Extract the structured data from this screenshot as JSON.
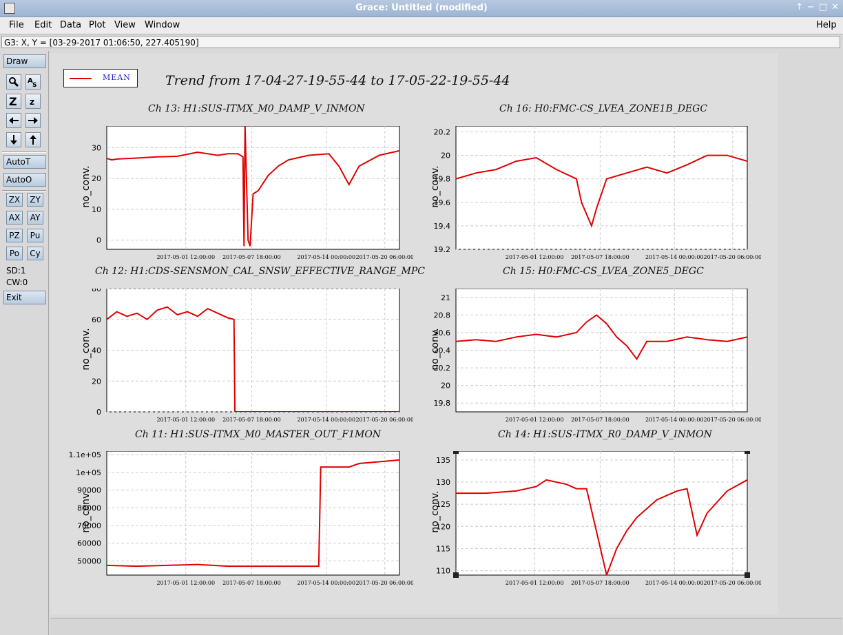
{
  "window": {
    "title": "Grace: Untitled (modified)",
    "controls": [
      "↑",
      "−",
      "□",
      "✕"
    ]
  },
  "menu": {
    "file": "File",
    "edit": "Edit",
    "data": "Data",
    "plot": "Plot",
    "view": "View",
    "window": "Window",
    "help": "Help"
  },
  "locator": "G3: X, Y = [03-29-2017 01:06:50, 227.405190]",
  "tools": {
    "draw": "Draw",
    "autot": "AutoT",
    "autoo": "AutoO",
    "exit": "Exit",
    "zx": "ZX",
    "zy": "ZY",
    "ax": "AX",
    "ay": "AY",
    "pz": "PZ",
    "pu": "Pu",
    "po": "Po",
    "cy": "Cy",
    "sd": "SD:1",
    "cw": "CW:0"
  },
  "legend": {
    "label": "MEAN",
    "color": "#e00000"
  },
  "main_title": "Trend from 17-04-27-19-55-44 to 17-05-22-19-55-44",
  "chart_data": [
    {
      "type": "line",
      "title": "Ch 13: H1:SUS-ITMX_M0_DAMP_V_INMON",
      "ylabel": "no_conv.",
      "yticks": [
        "0",
        "10",
        "20",
        "30"
      ],
      "xticks": [
        "2017-05-01 12:00:00",
        "2017-05-07 18:00:00",
        "2017-05-14 00:00:00",
        "2017-05-20 06:00:00"
      ],
      "ylim": [
        -3,
        37
      ],
      "series": [
        {
          "values": [
            [
              0,
              26.5
            ],
            [
              0.5,
              26
            ],
            [
              1,
              26.3
            ],
            [
              3,
              26.6
            ],
            [
              5,
              27
            ],
            [
              7,
              27.2
            ],
            [
              9,
              28.5
            ],
            [
              11,
              27.5
            ],
            [
              12,
              28
            ],
            [
              13,
              28
            ],
            [
              13.5,
              27
            ],
            [
              13.6,
              -2
            ],
            [
              13.7,
              37
            ],
            [
              14.0,
              0
            ],
            [
              14.2,
              -2
            ],
            [
              14.5,
              15
            ],
            [
              15,
              16
            ],
            [
              16,
              21
            ],
            [
              17,
              24
            ],
            [
              18,
              26
            ],
            [
              20,
              27.5
            ],
            [
              22,
              28
            ],
            [
              23,
              24
            ],
            [
              24,
              18
            ],
            [
              25,
              24
            ],
            [
              27,
              27.5
            ],
            [
              29,
              29
            ]
          ]
        }
      ]
    },
    {
      "type": "line",
      "title": "Ch 16: H0:FMC-CS_LVEA_ZONE1B_DEGC",
      "ylabel": "no_conv.",
      "yticks": [
        "19.2",
        "19.4",
        "19.6",
        "19.8",
        "20",
        "20.2"
      ],
      "xticks": [
        "2017-05-01 12:00:00",
        "2017-05-07 18:00:00",
        "2017-05-14 00:00:00",
        "2017-05-20 06:00:00"
      ],
      "ylim": [
        19.2,
        20.25
      ],
      "series": [
        {
          "values": [
            [
              0,
              19.8
            ],
            [
              2,
              19.85
            ],
            [
              4,
              19.88
            ],
            [
              6,
              19.95
            ],
            [
              8,
              19.98
            ],
            [
              10,
              19.88
            ],
            [
              12,
              19.8
            ],
            [
              12.5,
              19.6
            ],
            [
              13.5,
              19.4
            ],
            [
              14,
              19.55
            ],
            [
              15,
              19.8
            ],
            [
              17,
              19.85
            ],
            [
              19,
              19.9
            ],
            [
              21,
              19.85
            ],
            [
              23,
              19.92
            ],
            [
              25,
              20.0
            ],
            [
              27,
              20.0
            ],
            [
              29,
              19.95
            ]
          ]
        }
      ]
    },
    {
      "type": "line",
      "title": "Ch 12: H1:CDS-SENSMON_CAL_SNSW_EFFECTIVE_RANGE_MPC",
      "ylabel": "no_conv.",
      "yticks": [
        "0",
        "20",
        "40",
        "60",
        "80"
      ],
      "xticks": [
        "2017-05-01 12:00:00",
        "2017-05-07 18:00:00",
        "2017-05-14 00:00:00",
        "2017-05-20 06:00:00"
      ],
      "ylim": [
        0,
        80
      ],
      "series": [
        {
          "values": [
            [
              0,
              60
            ],
            [
              1,
              65
            ],
            [
              2,
              62
            ],
            [
              3,
              64
            ],
            [
              4,
              60
            ],
            [
              5,
              66
            ],
            [
              6,
              68
            ],
            [
              7,
              63
            ],
            [
              8,
              65
            ],
            [
              9,
              62
            ],
            [
              10,
              67
            ],
            [
              11,
              64
            ],
            [
              12,
              61
            ],
            [
              12.6,
              60
            ],
            [
              12.7,
              0
            ],
            [
              29,
              0
            ]
          ]
        }
      ]
    },
    {
      "type": "line",
      "title": "Ch 15: H0:FMC-CS_LVEA_ZONE5_DEGC",
      "ylabel": "no_conv.",
      "yticks": [
        "19.8",
        "20",
        "20.2",
        "20.4",
        "20.6",
        "20.8",
        "21"
      ],
      "xticks": [
        "2017-05-01 12:00:00",
        "2017-05-07 18:00:00",
        "2017-05-14 00:00:00",
        "2017-05-20 06:00:00"
      ],
      "ylim": [
        19.7,
        21.1
      ],
      "series": [
        {
          "values": [
            [
              0,
              20.5
            ],
            [
              2,
              20.52
            ],
            [
              4,
              20.5
            ],
            [
              6,
              20.55
            ],
            [
              8,
              20.58
            ],
            [
              10,
              20.55
            ],
            [
              12,
              20.6
            ],
            [
              13,
              20.72
            ],
            [
              14,
              20.8
            ],
            [
              15,
              20.7
            ],
            [
              16,
              20.55
            ],
            [
              17,
              20.45
            ],
            [
              18,
              20.3
            ],
            [
              19,
              20.5
            ],
            [
              21,
              20.5
            ],
            [
              23,
              20.55
            ],
            [
              25,
              20.52
            ],
            [
              27,
              20.5
            ],
            [
              29,
              20.55
            ]
          ]
        }
      ]
    },
    {
      "type": "line",
      "title": "Ch 11: H1:SUS-ITMX_M0_MASTER_OUT_F1MON",
      "ylabel": "no_conv.",
      "yticks": [
        "50000",
        "60000",
        "70000",
        "80000",
        "90000",
        "1e+05",
        "1.1e+05"
      ],
      "xticks": [
        "2017-05-01 12:00:00",
        "2017-05-07 18:00:00",
        "2017-05-14 00:00:00",
        "2017-05-20 06:00:00"
      ],
      "ylim": [
        42000,
        112000
      ],
      "series": [
        {
          "values": [
            [
              0,
              47500
            ],
            [
              3,
              47000
            ],
            [
              6,
              47500
            ],
            [
              9,
              48000
            ],
            [
              12,
              47000
            ],
            [
              15,
              47000
            ],
            [
              18,
              47000
            ],
            [
              21,
              47000
            ],
            [
              21.2,
              103000
            ],
            [
              24,
              103000
            ],
            [
              25,
              105000
            ],
            [
              29,
              107000
            ]
          ]
        }
      ]
    },
    {
      "type": "line",
      "title": "Ch 14: H1:SUS-ITMX_R0_DAMP_V_INMON",
      "ylabel": "no_conv.",
      "yticks": [
        "110",
        "115",
        "120",
        "125",
        "130",
        "135"
      ],
      "xticks": [
        "2017-05-01 12:00:00",
        "2017-05-07 18:00:00",
        "2017-05-14 00:00:00",
        "2017-05-20 06:00:00"
      ],
      "ylim": [
        109,
        137
      ],
      "series": [
        {
          "values": [
            [
              0,
              127.5
            ],
            [
              3,
              127.5
            ],
            [
              6,
              128
            ],
            [
              8,
              129
            ],
            [
              9,
              130.5
            ],
            [
              11,
              129.5
            ],
            [
              12,
              128.5
            ],
            [
              13,
              128.5
            ],
            [
              15,
              109
            ],
            [
              16,
              115
            ],
            [
              17,
              119
            ],
            [
              18,
              122
            ],
            [
              20,
              126
            ],
            [
              22,
              128
            ],
            [
              23,
              128.5
            ],
            [
              24,
              118
            ],
            [
              25,
              123
            ],
            [
              27,
              128
            ],
            [
              29,
              130.5
            ]
          ]
        }
      ]
    }
  ]
}
